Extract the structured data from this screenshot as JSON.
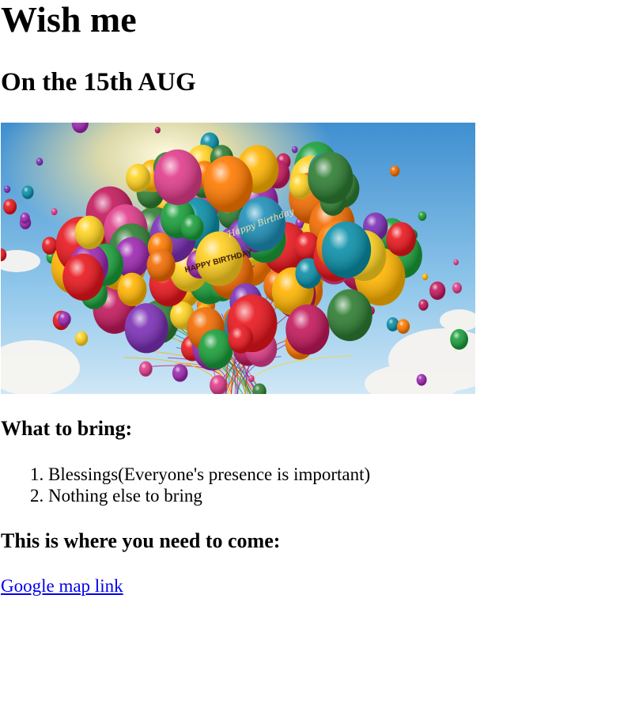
{
  "page": {
    "title": "Wish me",
    "subtitle": "On the 15th AUG"
  },
  "hero_image": {
    "icon": "birthday-balloons-image",
    "balloon_text_1": "Happy Birthday",
    "balloon_text_2": "HAPPY BIRTHDAY"
  },
  "bring": {
    "heading": "What to bring:",
    "items": [
      "Blessings(Everyone's presence is important)",
      "Nothing else to bring"
    ]
  },
  "location": {
    "heading": "This is where you need to come:",
    "link_label": "Google map link"
  },
  "colors": {
    "link": "#0000ee",
    "text": "#000000",
    "sky_top": "#3f8fd0",
    "sky_bottom": "#cfe7f6"
  }
}
